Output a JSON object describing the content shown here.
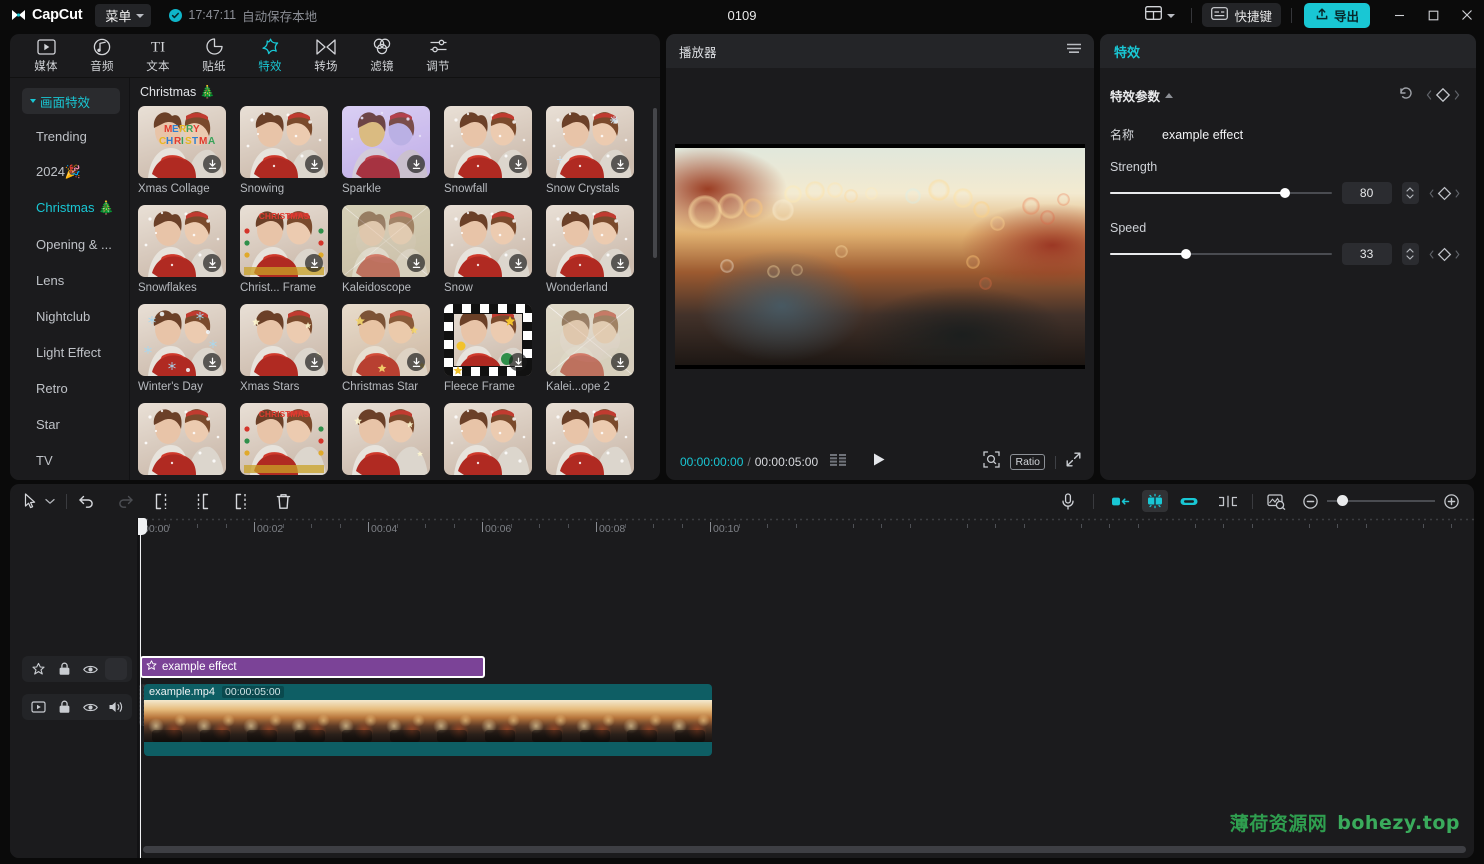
{
  "titlebar": {
    "app_name": "CapCut",
    "menu_label": "菜单",
    "autosave_time": "17:47:11",
    "autosave_text": "自动保存本地",
    "project_title": "0109",
    "shortcut_label": "快捷键",
    "export_label": "导出",
    "layout_icon": "layout-icon",
    "minimize_icon": "minimize-icon",
    "maximize_icon": "maximize-icon",
    "close_icon": "close-icon"
  },
  "library": {
    "tabs": [
      {
        "label": "媒体",
        "icon": "media-icon",
        "active": false
      },
      {
        "label": "音频",
        "icon": "audio-icon",
        "active": false
      },
      {
        "label": "文本",
        "icon": "text-icon",
        "active": false
      },
      {
        "label": "贴纸",
        "icon": "sticker-icon",
        "active": false
      },
      {
        "label": "特效",
        "icon": "effects-icon",
        "active": true
      },
      {
        "label": "转场",
        "icon": "transition-icon",
        "active": false
      },
      {
        "label": "滤镜",
        "icon": "filter-icon",
        "active": false
      },
      {
        "label": "调节",
        "icon": "adjust-icon",
        "active": false
      }
    ],
    "category_group": "画面特效",
    "categories": [
      {
        "label": "Trending",
        "selected": false
      },
      {
        "label": "2024🎉",
        "selected": false
      },
      {
        "label": "Christmas 🎄",
        "selected": true
      },
      {
        "label": "Opening & ...",
        "selected": false
      },
      {
        "label": "Lens",
        "selected": false
      },
      {
        "label": "Nightclub",
        "selected": false
      },
      {
        "label": "Light Effect",
        "selected": false
      },
      {
        "label": "Retro",
        "selected": false
      },
      {
        "label": "Star",
        "selected": false
      },
      {
        "label": "TV",
        "selected": false
      }
    ],
    "section_title": "Christmas 🎄",
    "items": [
      {
        "label": "Xmas Collage",
        "style": "collage"
      },
      {
        "label": "Snowing",
        "style": "plain"
      },
      {
        "label": "Sparkle",
        "style": "sparkle"
      },
      {
        "label": "Snowfall",
        "style": "plain"
      },
      {
        "label": "Snow Crystals",
        "style": "crystal"
      },
      {
        "label": "Snowflakes",
        "style": "flakes"
      },
      {
        "label": "Christ... Frame",
        "style": "frame"
      },
      {
        "label": "Kaleidoscope",
        "style": "kaleido"
      },
      {
        "label": "Snow",
        "style": "plain"
      },
      {
        "label": "Wonderland",
        "style": "plain"
      },
      {
        "label": "Winter's Day",
        "style": "winter"
      },
      {
        "label": "Xmas Stars",
        "style": "stars"
      },
      {
        "label": "Christmas Star",
        "style": "xstar"
      },
      {
        "label": "Fleece Frame",
        "style": "fleece"
      },
      {
        "label": "Kalei...ope 2",
        "style": "kaleido2"
      }
    ]
  },
  "player": {
    "title": "播放器",
    "menu_icon": "hamburger-icon",
    "current_time": "00:00:00:00",
    "time_separator": "/",
    "total_time": "00:00:05:00",
    "frames_icon": "frames-icon",
    "play_icon": "play-icon",
    "magnifier_icon": "magnifier-icon",
    "ratio_label": "Ratio",
    "fullscreen_icon": "fullscreen-icon"
  },
  "params": {
    "panel_title": "特效",
    "section_title": "特效参数",
    "reset_icon": "reset-icon",
    "keyframe_icon": "keyframe-diamond-icon",
    "name_label": "名称",
    "name_value": "example effect",
    "sliders": [
      {
        "label": "Strength",
        "value": "80",
        "percent": 76
      },
      {
        "label": "Speed",
        "value": "33",
        "percent": 33
      }
    ]
  },
  "timeline": {
    "toolbar_left": [
      {
        "icon": "select-cursor-icon",
        "name": "select-tool"
      },
      {
        "icon": "chevron-down-icon",
        "name": "select-tool-dropdown"
      },
      {
        "icon": "undo-icon",
        "name": "undo-button"
      },
      {
        "icon": "redo-icon",
        "name": "redo-button"
      },
      {
        "icon": "split-icon",
        "name": "split-button"
      },
      {
        "icon": "trim-left-icon",
        "name": "trim-left-button"
      },
      {
        "icon": "trim-right-icon",
        "name": "trim-right-button"
      },
      {
        "icon": "delete-icon",
        "name": "delete-button"
      }
    ],
    "toolbar_right": [
      {
        "icon": "microphone-icon",
        "name": "record-voiceover-button"
      },
      {
        "icon": "magnet-left-icon",
        "name": "adsorb-left-button"
      },
      {
        "icon": "auto-snap-icon",
        "name": "auto-snap-button"
      },
      {
        "icon": "link-icon",
        "name": "link-av-button"
      },
      {
        "icon": "gap-close-icon",
        "name": "close-gap-button"
      },
      {
        "icon": "preview-render-icon",
        "name": "preview-render-button"
      },
      {
        "icon": "zoom-out-icon",
        "name": "zoom-out-button"
      },
      {
        "icon": "zoom-in-icon",
        "name": "zoom-in-button"
      }
    ],
    "ruler_labels": [
      "00:00",
      "00:02",
      "00:04",
      "00:06",
      "00:08",
      "00:10"
    ],
    "effect_track": {
      "icons": [
        "star-effect-icon",
        "lock-icon",
        "eye-icon",
        "blank-icon"
      ],
      "clip_label": "example effect",
      "clip_icon": "effect-star-icon"
    },
    "video_track": {
      "icons": [
        "video-icon",
        "lock-icon",
        "eye-icon",
        "speaker-icon"
      ],
      "clip_name": "example.mp4",
      "clip_duration": "00:00:05:00"
    },
    "edit_button_icon": "pencil-icon"
  },
  "watermark": {
    "text_cn": "薄荷资源网",
    "text_en": "bohezy.top",
    "color": "#2f9e4f"
  },
  "colors": {
    "accent": "#19c7d4",
    "panel": "#1b1b1d",
    "effect_clip": "#7b4397",
    "video_clip": "#0e5e64"
  }
}
